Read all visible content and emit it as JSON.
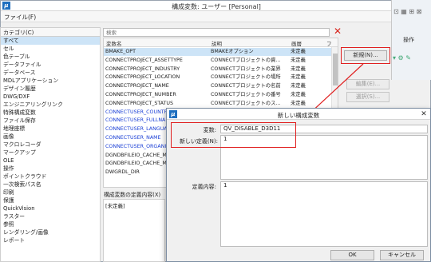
{
  "window": {
    "title": "構成変数: ユーザー [Personal]",
    "logo": "μ",
    "file_menu": "ファイル(F)"
  },
  "background_app": {
    "label": "操作",
    "icons_text": "⊡ ▦ ⊞ ⊠"
  },
  "categories": {
    "header": "カテゴリ(C)",
    "items": [
      "すべて",
      "セル",
      "色テーブル",
      "データファイル",
      "データベース",
      "MDLアプリケーション",
      "デザイン履歴",
      "DWG/DXF",
      "エンジニアリングリンク",
      "特殊構成変数",
      "ファイル保存",
      "地理座標",
      "画像",
      "マクロレコーダ",
      "マークアップ",
      "OLE",
      "操作",
      "ポイントクラウド",
      "一次検索パス名",
      "印刷",
      "保護",
      "QuickVision",
      "ラスター",
      "参照",
      "レンダリング/画像",
      "レポート"
    ],
    "selected_index": 0
  },
  "search": {
    "placeholder": "検索"
  },
  "table": {
    "headers": {
      "name": "変数名",
      "description": "説明",
      "level": "画層",
      "extra": "フ"
    },
    "rows": [
      {
        "name": "BMAKE_OPT",
        "description": "BMAKEオプション",
        "level": "未定義",
        "blue": false
      },
      {
        "name": "CONNECTPROJECT_ASSETTYPE",
        "description": "CONNECTプロジェクトの資...",
        "level": "未定義",
        "blue": false
      },
      {
        "name": "CONNECTPROJECT_INDUSTRY",
        "description": "CONNECTプロジェクトの業界",
        "level": "未定義",
        "blue": false
      },
      {
        "name": "CONNECTPROJECT_LOCATION",
        "description": "CONNECTプロジェクトの場所",
        "level": "未定義",
        "blue": false
      },
      {
        "name": "CONNECTPROJECT_NAME",
        "description": "CONNECTプロジェクトの名前",
        "level": "未定義",
        "blue": false
      },
      {
        "name": "CONNECTPROJECT_NUMBER",
        "description": "CONNECTプロジェクトの番号",
        "level": "未定義",
        "blue": false
      },
      {
        "name": "CONNECTPROJECT_STATUS",
        "description": "CONNECTプロジェクトのス...",
        "level": "未定義",
        "blue": false
      },
      {
        "name": "CONNECTUSER_COUNTRY",
        "description": "",
        "level": "",
        "blue": true
      },
      {
        "name": "CONNECTUSER_FULLNAME",
        "description": "",
        "level": "",
        "blue": true
      },
      {
        "name": "CONNECTUSER_LANGUAGE",
        "description": "",
        "level": "",
        "blue": true
      },
      {
        "name": "CONNECTUSER_NAME",
        "description": "",
        "level": "",
        "blue": true
      },
      {
        "name": "CONNECTUSER_ORGANIZ",
        "description": "",
        "level": "",
        "blue": true
      },
      {
        "name": "DGNDBFILEIO_CACHE_MA",
        "description": "",
        "level": "",
        "blue": false
      },
      {
        "name": "DGNDBFILEIO_CACHE_MA",
        "description": "",
        "level": "",
        "blue": false
      },
      {
        "name": "DWGRDL_DIR",
        "description": "",
        "level": "",
        "blue": false
      }
    ],
    "selected_index": 0
  },
  "buttons": {
    "new": "新規(N)...",
    "edit": "編集(E)...",
    "select": "選択(S)..."
  },
  "definition": {
    "label": "構成変数の定義内容(X)",
    "value": "[未定義]"
  },
  "dialog": {
    "title": "新しい構成変数",
    "logo": "μ",
    "close": "✕",
    "variable_label": "変数:",
    "variable_value": "QV_DISABLE_D3D11",
    "new_def_label": "新しい定義(N):",
    "new_def_value": "1",
    "def_content_label": "定義内容:",
    "def_content_value": "1",
    "ok": "OK",
    "cancel": "キャンセル"
  }
}
